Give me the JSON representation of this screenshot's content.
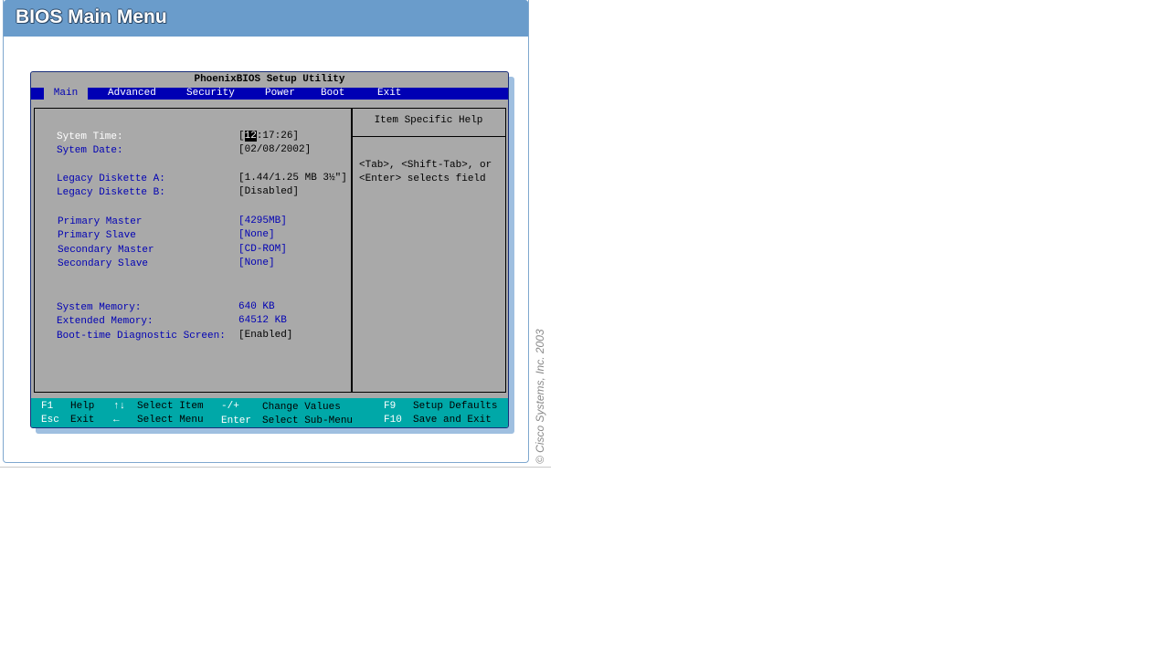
{
  "page": {
    "title": "BIOS Main Menu",
    "copyright": "© Cisco Systems, Inc. 2003"
  },
  "bios": {
    "title": "PhoenixBIOS Setup Utility",
    "menu": [
      "Main",
      "Advanced",
      "Security",
      "Power",
      "Boot",
      "Exit"
    ],
    "active_menu": "Main",
    "fields": {
      "system_time": {
        "label": "Sytem Time:",
        "value_prefix": "[",
        "value_highlight": "12",
        "value_suffix": ":17:26]"
      },
      "system_date": {
        "label": "Sytem Date:",
        "value": "[02/08/2002]"
      },
      "diskette_a": {
        "label": "Legacy Diskette A:",
        "value": "[1.44/1.25 MB 3½\"]"
      },
      "diskette_b": {
        "label": "Legacy Diskette B:",
        "value": "[Disabled]"
      },
      "primary_master": {
        "label": "Primary Master",
        "value": "[4295MB]"
      },
      "primary_slave": {
        "label": "Primary Slave",
        "value": "[None]"
      },
      "secondary_master": {
        "label": "Secondary Master",
        "value": "[CD-ROM]"
      },
      "secondary_slave": {
        "label": "Secondary Slave",
        "value": "[None]"
      },
      "system_memory": {
        "label": "System Memory:",
        "value": "640 KB"
      },
      "extended_memory": {
        "label": "Extended Memory:",
        "value": "64512 KB"
      },
      "boot_diag": {
        "label": "Boot-time Diagnostic Screen:",
        "value": "[Enabled]"
      }
    },
    "help": {
      "title": "Item Specific Help",
      "text": "<Tab>, <Shift-Tab>, or\n<Enter> selects field"
    },
    "footer": {
      "f1_key": "F1",
      "f1_desc": "Help",
      "updown_key": "↑↓",
      "updown_desc": "Select Item",
      "minusplus_key": "-/+",
      "minusplus_desc": "Change Values",
      "f9_key": "F9",
      "f9_desc": "Setup Defaults",
      "esc_key": "Esc",
      "esc_desc": "Exit",
      "left_key": "←",
      "left_desc": "Select Menu",
      "enter_key": "Enter",
      "enter_desc": "Select  Sub-Menu",
      "f10_key": "F10",
      "f10_desc": "Save and Exit"
    }
  },
  "colors": {
    "header": "#6a9ccb",
    "bios_bg": "#a9a9a9",
    "menu_bar": "#0000b4",
    "footer": "#00a8a8"
  }
}
